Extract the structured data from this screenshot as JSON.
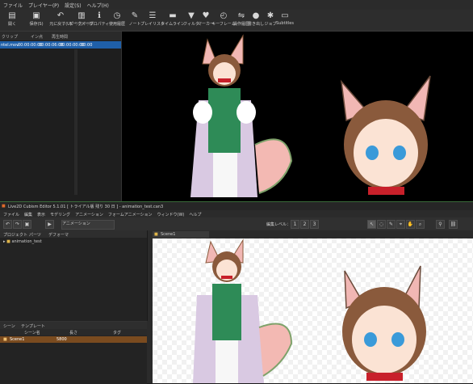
{
  "top_menu": [
    "ファイル",
    "プレイヤー(P)",
    "設定(S)",
    "ヘルプ(H)"
  ],
  "top_toolbar": [
    {
      "label": "開く",
      "icon": "folder-icon"
    },
    {
      "label": "保存(S)",
      "icon": "save-icon"
    },
    {
      "label": "元に戻す(U)",
      "icon": "undo-icon"
    },
    {
      "label": "やり直す(R)",
      "icon": "redo-icon"
    },
    {
      "label": "ピークメーター",
      "icon": "peak-meter-icon"
    },
    {
      "label": "プロパティ",
      "icon": "info-icon"
    },
    {
      "label": "使用履歴",
      "icon": "clock-icon"
    },
    {
      "label": "ノート",
      "icon": "note-icon"
    },
    {
      "label": "プレイリスト",
      "icon": "playlist-icon"
    },
    {
      "label": "タイムライン",
      "icon": "timeline-icon"
    },
    {
      "label": "フィルタ",
      "icon": "filter-icon"
    },
    {
      "label": "マーカー",
      "icon": "marker-icon"
    },
    {
      "label": "キーフレーム",
      "icon": "keyframe-icon"
    },
    {
      "label": "操作履歴",
      "icon": "history-icon"
    },
    {
      "label": "書き出し",
      "icon": "export-icon"
    },
    {
      "label": "ジョブ",
      "icon": "jobs-icon"
    },
    {
      "label": "Subtitles",
      "icon": "subtitles-icon"
    }
  ],
  "playlist": {
    "headers": [
      "クリップ",
      "イン点",
      "再生時間"
    ],
    "row": [
      "ntel.mov",
      "00:00:00:00",
      "00:00:06:06",
      "00:00:00:00",
      "00:00"
    ]
  },
  "cubism": {
    "title": "Live2D Cubism Editor 5.1.01  [ トライアル版 残り 30 日 ]  - animation_test.can3",
    "menu": [
      "ファイル",
      "編集",
      "表示",
      "モデリング",
      "アニメーション",
      "フォームアニメーション",
      "ウィンドウ(W)",
      "ヘルプ"
    ],
    "mode_select": "アニメーション",
    "toolbar_label": "編集レベル：",
    "project_tabs": [
      "プロジェクト",
      "パーツ",
      "デフォーマ"
    ],
    "project_item": "animation_test",
    "scene_tabs": [
      "シーン",
      "テンプレート"
    ],
    "scene_headers": [
      "シーン名",
      "長さ",
      "タグ"
    ],
    "scene_row": {
      "name": "Scene1",
      "length": "5800"
    },
    "canvas_tab": "Scene1"
  },
  "colors": {
    "selection_blue": "#1f5fa8",
    "scene_orange": "#7a4b1f",
    "vest_green": "#2e8b57",
    "hair_brown": "#8a5a3c",
    "ear_pink": "#f1b7b4",
    "collar_red": "#c8202a"
  }
}
